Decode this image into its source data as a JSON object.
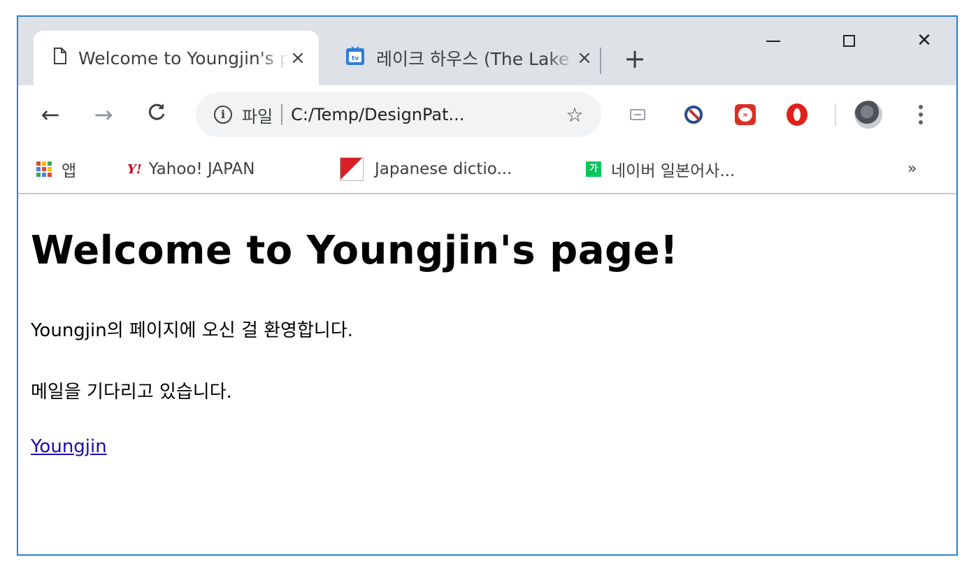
{
  "tabs": [
    {
      "title": "Welcome to Youngjin's page!",
      "close": "×",
      "active": true,
      "icon": "page-icon"
    },
    {
      "title": "레이크 하우스 (The Lake House)",
      "close": "×",
      "active": false,
      "icon": "tv-icon"
    }
  ],
  "new_tab": "+",
  "window_controls": {
    "close": "✕"
  },
  "toolbar": {
    "back": "←",
    "forward": "→",
    "reload": "C",
    "info_icon": "ⓘ",
    "scheme": "파일",
    "url": "C:/Temp/DesignPat...",
    "star": "☆"
  },
  "bookmarks": {
    "apps": "앱",
    "yahoo_logo": "Y!",
    "yahoo": "Yahoo! JAPAN",
    "jdict": "Japanese dictio...",
    "naver_icon": "가",
    "naver": "네이버 일본어사...",
    "more": "»"
  },
  "page": {
    "heading": "Welcome to Youngjin's page!",
    "para1": "Youngjin의 페이지에 오신 걸 환영합니다.",
    "para2": "메일을 기다리고 있습니다.",
    "link": "Youngjin"
  },
  "colors": {
    "window_border": "#2b7fd3",
    "tabstrip_bg": "#dee1e6",
    "link": "#1a0dab",
    "apps_dots": [
      "#ea4335",
      "#fbbc04",
      "#34a853",
      "#4285f4",
      "#ea4335",
      "#fbbc04",
      "#34a853",
      "#4285f4",
      "#ea4335"
    ]
  }
}
